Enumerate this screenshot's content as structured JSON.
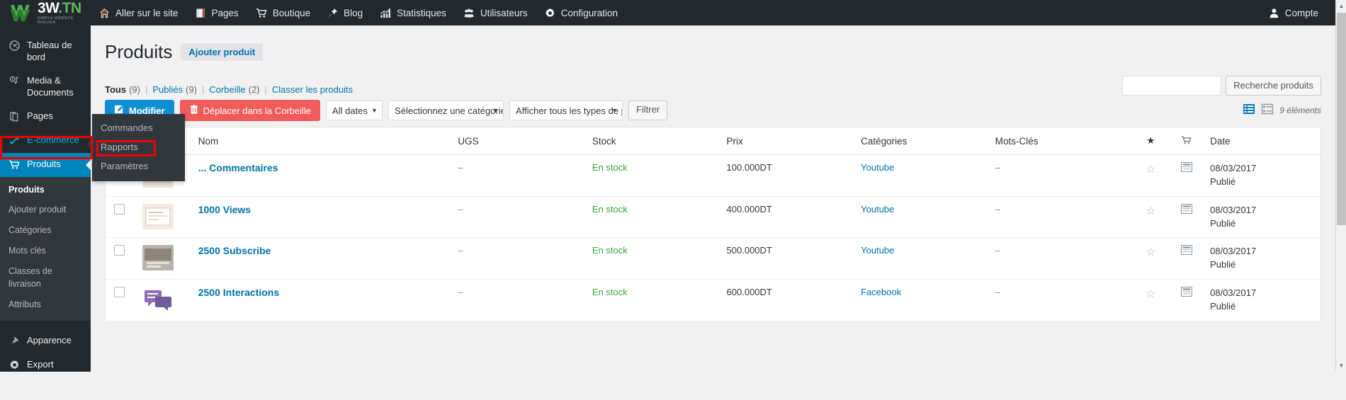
{
  "adminbar": {
    "logo": {
      "main_w3": "3W",
      "main_tn": ".TN",
      "sub": "SIMPLE WEBSITE BUILDER"
    },
    "items": [
      {
        "label": "Aller sur le site",
        "icon": "home-icon"
      },
      {
        "label": "Pages",
        "icon": "pages-icon"
      },
      {
        "label": "Boutique",
        "icon": "cart-icon"
      },
      {
        "label": "Blog",
        "icon": "pin-icon"
      },
      {
        "label": "Statistiques",
        "icon": "chart-icon"
      },
      {
        "label": "Utilisateurs",
        "icon": "users-icon"
      },
      {
        "label": "Configuration",
        "icon": "gear-icon"
      }
    ],
    "account": {
      "label": "Compte",
      "icon": "user-icon"
    }
  },
  "sidebar": {
    "items": [
      {
        "label": "Tableau de bord",
        "icon": "dashboard-icon"
      },
      {
        "label": "Media & Documents",
        "icon": "media-icon"
      },
      {
        "label": "Pages",
        "icon": "pages-icon"
      },
      {
        "label": "E-commerce",
        "icon": "ecommerce-icon"
      },
      {
        "label": "Produits",
        "icon": "cart-icon"
      },
      {
        "label": "Apparence",
        "icon": "brush-icon"
      },
      {
        "label": "Export Structure Theme",
        "icon": "gear-icon"
      }
    ],
    "produits_submenu": [
      "Produits",
      "Ajouter produit",
      "Catégories",
      "Mots clés",
      "Classes de livraison",
      "Attributs"
    ],
    "flyout": {
      "items": [
        "Commandes",
        "Rapports",
        "Paramètres"
      ]
    }
  },
  "page": {
    "title": "Produits",
    "add_button": "Ajouter produit"
  },
  "views": {
    "all": {
      "label": "Tous",
      "count": "(9)"
    },
    "published": {
      "label": "Publiés",
      "count": "(9)"
    },
    "trash": {
      "label": "Corbeille",
      "count": "(2)"
    },
    "sort": {
      "label": "Classer les produits"
    },
    "separator": "|"
  },
  "toolbar": {
    "edit_label": "Modifier",
    "trash_label": "Déplacer dans la Corbeille",
    "date_filter": "All dates",
    "category_filter": "Sélectionnez une catégorie",
    "type_filter": "Afficher tous les types de p",
    "filter_label": "Filtrer",
    "caret": "▼"
  },
  "search": {
    "value": "",
    "placeholder": "",
    "button_label": "Recherche produits"
  },
  "view_switch": {
    "list_icon": "list-view-icon",
    "excerpt_icon": "excerpt-view-icon",
    "displaying_num": "9 éléments"
  },
  "table": {
    "headers": [
      "",
      "",
      "Nom",
      "UGS",
      "Stock",
      "Prix",
      "Catégories",
      "Mots-Clés",
      "★",
      "cart-icon",
      "Date"
    ],
    "rows": [
      {
        "name": "... Commentaires",
        "ugs": "–",
        "stock": "En stock",
        "prix": "100.000DT",
        "categorie": "Youtube",
        "mots_cles": "–",
        "date": "08/03/2017",
        "status": "Publié",
        "thumb_colors": [
          "#e8e4dc",
          "#c9b7a0",
          "#ffffff"
        ]
      },
      {
        "name": "1000 Views",
        "ugs": "–",
        "stock": "En stock",
        "prix": "400.000DT",
        "categorie": "Youtube",
        "mots_cles": "–",
        "date": "08/03/2017",
        "status": "Publié",
        "thumb_colors": [
          "#f2ece2",
          "#d8c7b3",
          "#ffffff"
        ]
      },
      {
        "name": "2500 Subscribe",
        "ugs": "–",
        "stock": "En stock",
        "prix": "500.000DT",
        "categorie": "Youtube",
        "mots_cles": "–",
        "date": "08/03/2017",
        "status": "Publié",
        "thumb_colors": [
          "#b9b4ab",
          "#8d867c",
          "#e7e4dd"
        ]
      },
      {
        "name": "2500 Interactions",
        "ugs": "–",
        "stock": "En stock",
        "prix": "600.000DT",
        "categorie": "Facebook",
        "mots_cles": "–",
        "date": "08/03/2017",
        "status": "Publié",
        "thumb_colors": [
          "#8e6fb5",
          "#ffffff",
          "#6f5a9a"
        ]
      }
    ]
  },
  "colors": {
    "admin_bg": "#23282d",
    "submenu_bg": "#32373c",
    "accent_blue": "#0073aa",
    "current_blue": "#0085ba",
    "link_blue": "#00b9eb",
    "edit_button": "#0e8fd4",
    "trash_button": "#f05b5b",
    "in_stock_green": "#3aa33a",
    "annotation_red": "#ee0000",
    "logo_green": "#5cb85c"
  }
}
